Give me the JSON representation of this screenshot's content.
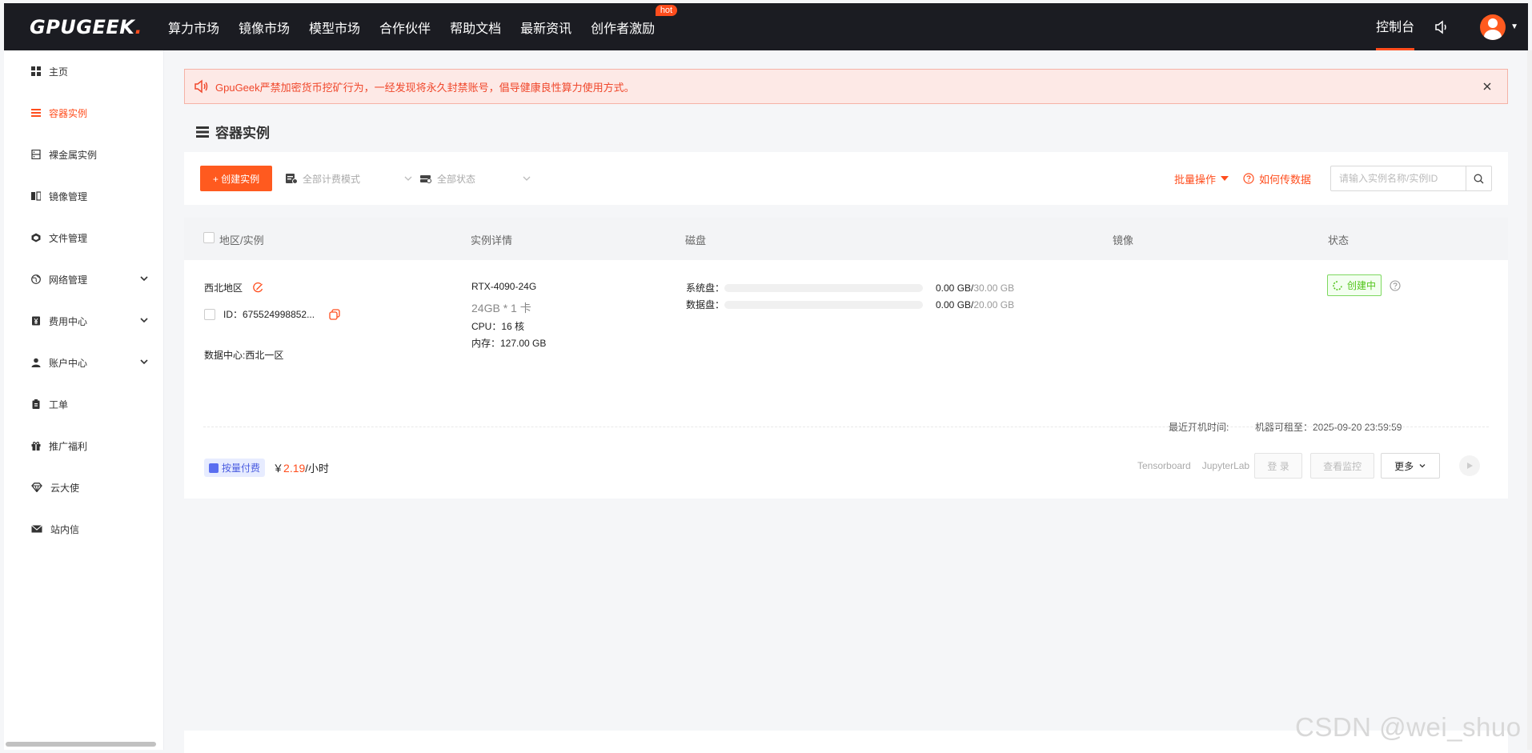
{
  "brand": {
    "logo_main": "GPUGEEK",
    "logo_dot": "."
  },
  "nav": {
    "items": [
      "算力市场",
      "镜像市场",
      "模型市场",
      "合作伙伴",
      "帮助文档",
      "最新资讯",
      "创作者激励"
    ],
    "hot_badge": "hot",
    "console": "控制台"
  },
  "sidebar": {
    "items": [
      {
        "label": "主页",
        "icon": "grid-icon"
      },
      {
        "label": "容器实例",
        "icon": "list-icon",
        "active": true
      },
      {
        "label": "裸金属实例",
        "icon": "server-icon"
      },
      {
        "label": "镜像管理",
        "icon": "image-icon"
      },
      {
        "label": "文件管理",
        "icon": "box-icon"
      },
      {
        "label": "网络管理",
        "icon": "globe-icon",
        "expandable": true
      },
      {
        "label": "费用中心",
        "icon": "yen-icon",
        "expandable": true
      },
      {
        "label": "账户中心",
        "icon": "user-icon",
        "expandable": true
      },
      {
        "label": "工单",
        "icon": "clipboard-icon"
      },
      {
        "label": "推广福利",
        "icon": "gift-icon"
      },
      {
        "label": "云大使",
        "icon": "diamond-icon"
      },
      {
        "label": "站内信",
        "icon": "mail-icon"
      }
    ]
  },
  "notice": {
    "text": "GpuGeek严禁加密货币挖矿行为，一经发现将永久封禁账号，倡导健康良性算力使用方式。"
  },
  "page": {
    "title": "容器实例"
  },
  "toolbar": {
    "create_label": "+ 创建实例",
    "billing_filter": "全部计费模式",
    "status_filter": "全部状态",
    "batch_label": "批量操作",
    "howto_label": "如何传数据",
    "search_placeholder": "请输入实例名称/实例ID"
  },
  "table": {
    "headers": {
      "region": "地区/实例",
      "details": "实例详情",
      "disk": "磁盘",
      "image": "镜像",
      "status": "状态"
    },
    "row": {
      "region": "西北地区",
      "id": "ID：675524998852...",
      "datacenter": "数据中心:西北一区",
      "gpu_model": "RTX-4090-24G",
      "gpu_spec": "24GB * 1 卡",
      "cpu": "CPU：16 核",
      "memory": "内存：127.00 GB",
      "disks": [
        {
          "label": "系统盘：",
          "used": "0.00 GB",
          "sep": " / ",
          "total": "30.00 GB",
          "fraction": 0
        },
        {
          "label": "数据盘：",
          "used": "0.00 GB",
          "sep": " / ",
          "total": "20.00 GB",
          "fraction": 0
        }
      ],
      "status": "创建中",
      "last_boot_label": "最近开机时间:",
      "rent_until": "机器可租至：2025-09-20 23:59:59",
      "billing_tag": "按量付费",
      "price_currency": "￥",
      "price_value": "2.19",
      "price_unit": "/小时",
      "tensorboard": "Tensorboard",
      "jupyterlab": "JupyterLab",
      "login": "登 录",
      "monitor": "查看监控",
      "more": "更多"
    }
  },
  "colors": {
    "accent": "#ff4d1d",
    "topbar": "#1b1c22",
    "status_green": "#52c41a"
  },
  "watermark": "CSDN @wei_shuo"
}
